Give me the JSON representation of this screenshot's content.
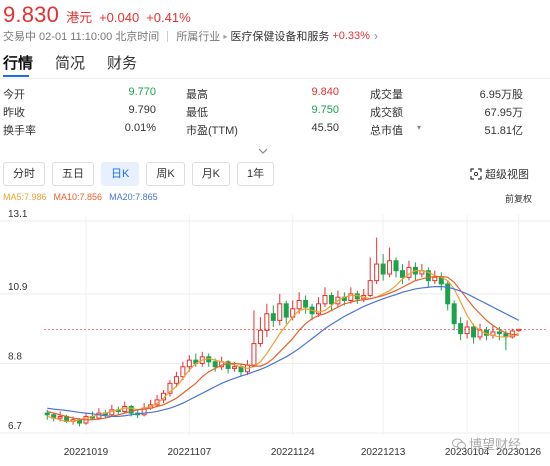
{
  "quote": {
    "price": "9.830",
    "currency": "港元",
    "change": "+0.040",
    "change_pct": "+0.41%"
  },
  "status": {
    "trade_time": "交易中 02-01 11:10:00 北京时间",
    "industry_label": "所属行业",
    "industry_name": "医疗保健设备和服务",
    "industry_change": "+0.33%"
  },
  "tabs": [
    {
      "label": "行情",
      "active": true
    },
    {
      "label": "简况",
      "active": false
    },
    {
      "label": "财务",
      "active": false
    }
  ],
  "stats": [
    [
      {
        "label": "今开",
        "value": "9.770",
        "color": "green"
      },
      {
        "label": "最高",
        "value": "9.840",
        "color": "red"
      },
      {
        "label": "成交量",
        "value": "6.95万股",
        "color": "gray"
      }
    ],
    [
      {
        "label": "昨收",
        "value": "9.790",
        "color": "gray"
      },
      {
        "label": "最低",
        "value": "9.750",
        "color": "green"
      },
      {
        "label": "成交额",
        "value": "67.95万",
        "color": "gray"
      }
    ],
    [
      {
        "label": "换手率",
        "value": "0.01%",
        "color": "gray"
      },
      {
        "label": "市盈(TTM)",
        "value": "45.50",
        "color": "gray"
      },
      {
        "label": "总市值",
        "value": "51.81亿",
        "color": "gray"
      }
    ]
  ],
  "expand_icon": "chevron-down-icon",
  "periods": [
    {
      "label": "分时",
      "active": false
    },
    {
      "label": "五日",
      "active": false
    },
    {
      "label": "日K",
      "active": true
    },
    {
      "label": "周K",
      "active": false
    },
    {
      "label": "月K",
      "active": false
    },
    {
      "label": "1年",
      "active": false
    }
  ],
  "super_view": {
    "label": "超级视图",
    "icon": "expand-view-icon"
  },
  "ma_legend": {
    "ma5": "MA5:7.986",
    "ma10": "MA10:7.856",
    "ma20": "MA20:7.865"
  },
  "adjust_label": "前复权",
  "watermark": "博望财经",
  "colors": {
    "up": "#e93030",
    "down": "#1aa34a",
    "accent": "#1e6fe8",
    "ma5": "#f0a030",
    "ma10": "#e8602c",
    "ma20": "#4a73d8"
  },
  "chart_data": {
    "type": "candlestick",
    "ylim": [
      6.7,
      13.1
    ],
    "y_ticks": [
      "13.1",
      "10.9",
      "8.8",
      "6.7"
    ],
    "x_ticks": [
      "20221019",
      "20221107",
      "20221124",
      "20221213",
      "20230104",
      "20230126"
    ],
    "series": [
      {
        "name": "MA5",
        "values": [
          7.2,
          7.15,
          7.1,
          7.05,
          7.05,
          7.1,
          7.15,
          7.2,
          7.25,
          7.3,
          7.35,
          7.4,
          7.45,
          7.45,
          7.4,
          7.45,
          7.5,
          7.6,
          7.75,
          7.95,
          8.1,
          8.35,
          8.6,
          8.8,
          8.9,
          8.95,
          8.9,
          8.85,
          8.8,
          8.75,
          8.7,
          8.65,
          8.7,
          8.85,
          9.1,
          9.4,
          9.7,
          9.95,
          10.2,
          10.4,
          10.45,
          10.4,
          10.35,
          10.4,
          10.55,
          10.7,
          10.8,
          10.85,
          10.85,
          10.8,
          10.75,
          10.8,
          10.9,
          11.0,
          11.15,
          11.35,
          11.5,
          11.6,
          11.6,
          11.55,
          11.45,
          11.4,
          11.3,
          11.05,
          10.65,
          10.25,
          9.95,
          9.8,
          9.7,
          9.65,
          9.6,
          9.6,
          9.65,
          9.7
        ]
      },
      {
        "name": "MA10",
        "values": [
          7.35,
          7.3,
          7.25,
          7.2,
          7.15,
          7.12,
          7.1,
          7.1,
          7.12,
          7.15,
          7.2,
          7.25,
          7.3,
          7.35,
          7.4,
          7.42,
          7.45,
          7.5,
          7.55,
          7.65,
          7.75,
          7.9,
          8.05,
          8.2,
          8.4,
          8.55,
          8.65,
          8.75,
          8.8,
          8.8,
          8.78,
          8.75,
          8.72,
          8.72,
          8.8,
          8.95,
          9.15,
          9.35,
          9.55,
          9.8,
          10.0,
          10.15,
          10.25,
          10.3,
          10.4,
          10.5,
          10.6,
          10.65,
          10.7,
          10.72,
          10.75,
          10.8,
          10.85,
          10.92,
          11.0,
          11.1,
          11.2,
          11.3,
          11.35,
          11.4,
          11.42,
          11.42,
          11.4,
          11.25,
          11.0,
          10.75,
          10.5,
          10.3,
          10.1,
          9.95,
          9.82,
          9.72,
          9.68,
          9.65
        ]
      },
      {
        "name": "MA20",
        "values": [
          7.45,
          7.42,
          7.4,
          7.38,
          7.35,
          7.32,
          7.3,
          7.28,
          7.25,
          7.22,
          7.2,
          7.2,
          7.22,
          7.25,
          7.28,
          7.3,
          7.32,
          7.35,
          7.4,
          7.45,
          7.52,
          7.6,
          7.7,
          7.8,
          7.9,
          8.0,
          8.1,
          8.2,
          8.28,
          8.35,
          8.42,
          8.48,
          8.55,
          8.62,
          8.7,
          8.8,
          8.9,
          9.0,
          9.12,
          9.25,
          9.4,
          9.55,
          9.7,
          9.85,
          9.98,
          10.1,
          10.22,
          10.32,
          10.42,
          10.52,
          10.6,
          10.68,
          10.75,
          10.82,
          10.88,
          10.95,
          11.0,
          11.05,
          11.08,
          11.1,
          11.12,
          11.12,
          11.1,
          11.05,
          10.98,
          10.9,
          10.8,
          10.7,
          10.6,
          10.5,
          10.4,
          10.3,
          10.2,
          10.1
        ]
      }
    ],
    "candles": [
      [
        7.3,
        7.25,
        7.4,
        7.1
      ],
      [
        7.25,
        7.15,
        7.3,
        7.05
      ],
      [
        7.15,
        7.2,
        7.35,
        7.05
      ],
      [
        7.2,
        7.05,
        7.25,
        7.0
      ],
      [
        7.05,
        7.1,
        7.2,
        6.95
      ],
      [
        7.1,
        7.0,
        7.15,
        6.9
      ],
      [
        7.0,
        7.2,
        7.3,
        6.95
      ],
      [
        7.2,
        7.15,
        7.35,
        7.1
      ],
      [
        7.15,
        7.3,
        7.45,
        7.1
      ],
      [
        7.3,
        7.25,
        7.4,
        7.15
      ],
      [
        7.25,
        7.4,
        7.55,
        7.2
      ],
      [
        7.4,
        7.35,
        7.5,
        7.25
      ],
      [
        7.35,
        7.5,
        7.65,
        7.3
      ],
      [
        7.5,
        7.3,
        7.55,
        7.2
      ],
      [
        7.3,
        7.25,
        7.4,
        7.15
      ],
      [
        7.25,
        7.45,
        7.6,
        7.2
      ],
      [
        7.45,
        7.55,
        7.7,
        7.4
      ],
      [
        7.55,
        7.7,
        7.85,
        7.5
      ],
      [
        7.7,
        7.9,
        8.0,
        7.6
      ],
      [
        7.9,
        8.2,
        8.3,
        7.8
      ],
      [
        8.2,
        8.4,
        8.55,
        8.1
      ],
      [
        8.4,
        8.7,
        8.85,
        8.3
      ],
      [
        8.7,
        8.9,
        9.05,
        8.55
      ],
      [
        8.9,
        8.8,
        9.1,
        8.7
      ],
      [
        8.8,
        9.0,
        9.15,
        8.7
      ],
      [
        9.0,
        8.85,
        9.1,
        8.7
      ],
      [
        8.85,
        8.7,
        8.95,
        8.55
      ],
      [
        8.7,
        8.85,
        9.0,
        8.6
      ],
      [
        8.85,
        8.65,
        8.9,
        8.5
      ],
      [
        8.65,
        8.7,
        8.85,
        8.55
      ],
      [
        8.7,
        8.55,
        8.8,
        8.4
      ],
      [
        8.55,
        8.75,
        8.9,
        8.45
      ],
      [
        8.75,
        9.4,
        10.4,
        8.7
      ],
      [
        9.4,
        9.8,
        10.2,
        9.3
      ],
      [
        9.8,
        10.3,
        10.6,
        9.6
      ],
      [
        10.3,
        10.1,
        10.55,
        9.9
      ],
      [
        10.1,
        10.6,
        10.9,
        9.95
      ],
      [
        10.6,
        10.2,
        10.7,
        10.0
      ],
      [
        10.2,
        10.45,
        10.7,
        10.1
      ],
      [
        10.45,
        10.7,
        10.95,
        10.3
      ],
      [
        10.7,
        10.5,
        10.85,
        10.3
      ],
      [
        10.5,
        10.3,
        10.6,
        10.1
      ],
      [
        10.3,
        10.6,
        10.8,
        10.2
      ],
      [
        10.6,
        10.85,
        11.1,
        10.5
      ],
      [
        10.85,
        10.6,
        10.95,
        10.4
      ],
      [
        10.6,
        10.8,
        11.0,
        10.5
      ],
      [
        10.8,
        10.7,
        10.95,
        10.55
      ],
      [
        10.7,
        10.9,
        11.1,
        10.6
      ],
      [
        10.9,
        10.75,
        11.0,
        10.6
      ],
      [
        10.75,
        10.85,
        11.05,
        10.65
      ],
      [
        10.85,
        11.3,
        12.0,
        10.8
      ],
      [
        11.3,
        11.8,
        12.6,
        11.2
      ],
      [
        11.8,
        11.5,
        12.1,
        11.3
      ],
      [
        11.5,
        11.9,
        12.3,
        11.4
      ],
      [
        11.9,
        11.6,
        12.0,
        11.4
      ],
      [
        11.6,
        11.4,
        11.8,
        11.2
      ],
      [
        11.4,
        11.7,
        11.9,
        11.3
      ],
      [
        11.7,
        11.5,
        11.85,
        11.3
      ],
      [
        11.5,
        11.6,
        11.8,
        11.4
      ],
      [
        11.6,
        11.3,
        11.7,
        11.1
      ],
      [
        11.3,
        11.4,
        11.6,
        11.2
      ],
      [
        11.4,
        11.2,
        11.55,
        11.0
      ],
      [
        11.2,
        10.6,
        11.3,
        10.4
      ],
      [
        10.6,
        10.0,
        10.7,
        9.8
      ],
      [
        10.0,
        9.7,
        10.2,
        9.5
      ],
      [
        9.7,
        9.9,
        10.1,
        9.55
      ],
      [
        9.9,
        9.6,
        10.0,
        9.4
      ],
      [
        9.6,
        9.8,
        10.0,
        9.5
      ],
      [
        9.8,
        9.65,
        9.9,
        9.5
      ],
      [
        9.65,
        9.75,
        9.95,
        9.55
      ],
      [
        9.75,
        9.7,
        9.9,
        9.5
      ],
      [
        9.7,
        9.6,
        9.8,
        9.2
      ],
      [
        9.6,
        9.78,
        9.85,
        9.55
      ],
      [
        9.79,
        9.83,
        9.84,
        9.75
      ]
    ]
  }
}
